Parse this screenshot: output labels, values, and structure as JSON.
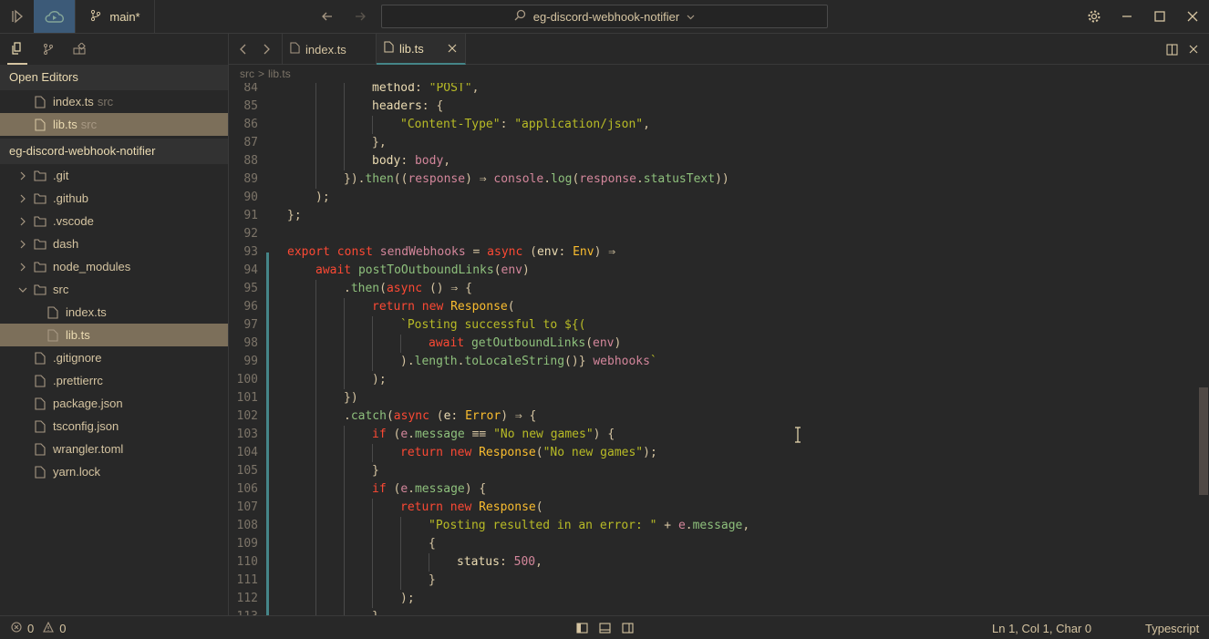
{
  "titlebar": {
    "branch": "main*",
    "project": "eg-discord-webhook-notifier"
  },
  "sidebar": {
    "open_editors_title": "Open Editors",
    "open_editors": [
      {
        "name": "index.ts",
        "dir": "src"
      },
      {
        "name": "lib.ts",
        "dir": "src"
      }
    ],
    "project_title": "eg-discord-webhook-notifier",
    "tree": [
      {
        "name": ".git",
        "kind": "folder"
      },
      {
        "name": ".github",
        "kind": "folder"
      },
      {
        "name": ".vscode",
        "kind": "folder"
      },
      {
        "name": "dash",
        "kind": "folder"
      },
      {
        "name": "node_modules",
        "kind": "folder"
      },
      {
        "name": "src",
        "kind": "folder-open"
      },
      {
        "name": "index.ts",
        "kind": "file-nested"
      },
      {
        "name": "lib.ts",
        "kind": "file-nested"
      },
      {
        "name": ".gitignore",
        "kind": "file"
      },
      {
        "name": ".prettierrc",
        "kind": "file"
      },
      {
        "name": "package.json",
        "kind": "file"
      },
      {
        "name": "tsconfig.json",
        "kind": "file"
      },
      {
        "name": "wrangler.toml",
        "kind": "file"
      },
      {
        "name": "yarn.lock",
        "kind": "file"
      }
    ]
  },
  "tabs": [
    {
      "label": "index.ts"
    },
    {
      "label": "lib.ts"
    }
  ],
  "breadcrumb": {
    "dir": "src",
    "sep": ">",
    "file": "lib.ts"
  },
  "code_lines": [
    {
      "n": "84",
      "t": "method: \"POST\","
    },
    {
      "n": "85",
      "t": "headers: {"
    },
    {
      "n": "86",
      "t": "\"Content-Type\": \"application/json\","
    },
    {
      "n": "87",
      "t": "},"
    },
    {
      "n": "88",
      "t": "body: body,"
    },
    {
      "n": "89",
      "t": "}).then((response) ⇒ console.log(response.statusText))"
    },
    {
      "n": "90",
      "t": ");"
    },
    {
      "n": "91",
      "t": "};"
    },
    {
      "n": "92",
      "t": ""
    },
    {
      "n": "93",
      "t": "export const sendWebhooks = async (env: Env) ⇒"
    },
    {
      "n": "94",
      "t": "await postToOutboundLinks(env)"
    },
    {
      "n": "95",
      "t": ".then(async () ⇒ {"
    },
    {
      "n": "96",
      "t": "return new Response("
    },
    {
      "n": "97",
      "t": "`Posting successful to ${("
    },
    {
      "n": "98",
      "t": "await getOutboundLinks(env)"
    },
    {
      "n": "99",
      "t": ").length.toLocaleString()} webhooks`"
    },
    {
      "n": "100",
      "t": ");"
    },
    {
      "n": "101",
      "t": "})"
    },
    {
      "n": "102",
      "t": ".catch(async (e: Error) ⇒ {"
    },
    {
      "n": "103",
      "t": "if (e.message ≡≡ \"No new games\") {"
    },
    {
      "n": "104",
      "t": "return new Response(\"No new games\");"
    },
    {
      "n": "105",
      "t": "}"
    },
    {
      "n": "106",
      "t": "if (e.message) {"
    },
    {
      "n": "107",
      "t": "return new Response("
    },
    {
      "n": "108",
      "t": "\"Posting resulted in an error: \" + e.message,"
    },
    {
      "n": "109",
      "t": "{"
    },
    {
      "n": "110",
      "t": "status: 500,"
    },
    {
      "n": "111",
      "t": "}"
    },
    {
      "n": "112",
      "t": ");"
    },
    {
      "n": "113",
      "t": "}"
    }
  ],
  "status": {
    "errors": "0",
    "warnings": "0",
    "position": "Ln 1, Col 1, Char 0",
    "language": "Typescript"
  },
  "colors": {
    "background": "#282828",
    "accent": "#458588",
    "selection": "#7c6f5a",
    "keyword": "#fb4934",
    "string": "#b8bb26",
    "function": "#8ec07c",
    "variable": "#d3869b",
    "type": "#fabd2f"
  }
}
